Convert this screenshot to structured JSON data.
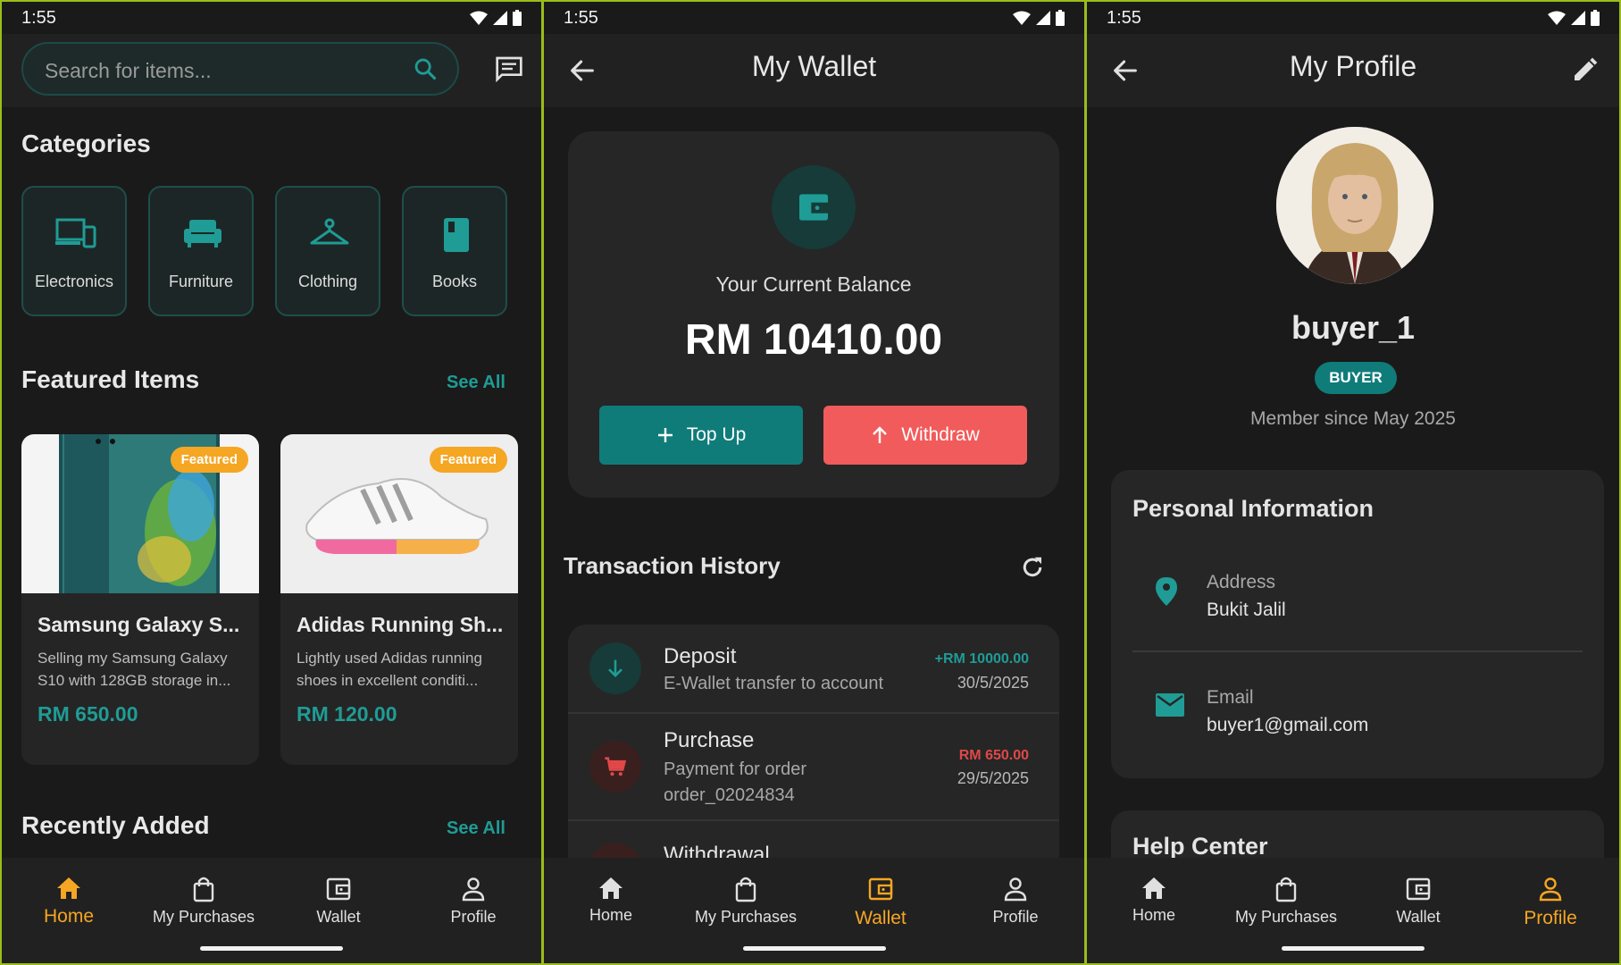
{
  "status_time": "1:55",
  "nav": {
    "home": "Home",
    "purchases": "My Purchases",
    "wallet": "Wallet",
    "profile": "Profile"
  },
  "screen1": {
    "search_placeholder": "Search for items...",
    "categories_title": "Categories",
    "categories": [
      {
        "label": "Electronics",
        "icon": "devices-icon"
      },
      {
        "label": "Furniture",
        "icon": "sofa-icon"
      },
      {
        "label": "Clothing",
        "icon": "hanger-icon"
      },
      {
        "label": "Books",
        "icon": "book-icon"
      }
    ],
    "featured_title": "Featured Items",
    "see_all": "See All",
    "items": [
      {
        "badge": "Featured",
        "name": "Samsung Galaxy S...",
        "desc": "Selling my Samsung Galaxy S10 with 128GB storage in...",
        "price": "RM 650.00"
      },
      {
        "badge": "Featured",
        "name": "Adidas Running Sh...",
        "desc": "Lightly used Adidas running shoes in excellent conditi...",
        "price": "RM 120.00"
      }
    ],
    "recent_title": "Recently Added"
  },
  "screen2": {
    "title": "My Wallet",
    "balance_label": "Your Current Balance",
    "balance": "RM 10410.00",
    "topup": "Top Up",
    "withdraw": "Withdraw",
    "history_title": "Transaction History",
    "transactions": [
      {
        "title": "Deposit",
        "desc": "E-Wallet transfer to account",
        "amount": "+RM 10000.00",
        "date": "30/5/2025",
        "color": "#1f9c95"
      },
      {
        "title": "Purchase",
        "desc": "Payment for order order_02024834",
        "amount": "RM 650.00",
        "date": "29/5/2025",
        "color": "#e04848"
      },
      {
        "title": "Withdrawal",
        "desc": "",
        "amount": "",
        "date": "",
        "color": "#e04848"
      }
    ]
  },
  "screen3": {
    "title": "My Profile",
    "username": "buyer_1",
    "role": "BUYER",
    "member_since": "Member since May 2025",
    "personal_title": "Personal Information",
    "address_label": "Address",
    "address_value": "Bukit Jalil",
    "email_label": "Email",
    "email_value": "buyer1@gmail.com",
    "help_title": "Help Center"
  },
  "colors": {
    "accent": "#1f9c95",
    "orange": "#f5a623",
    "danger": "#f25b5b"
  }
}
